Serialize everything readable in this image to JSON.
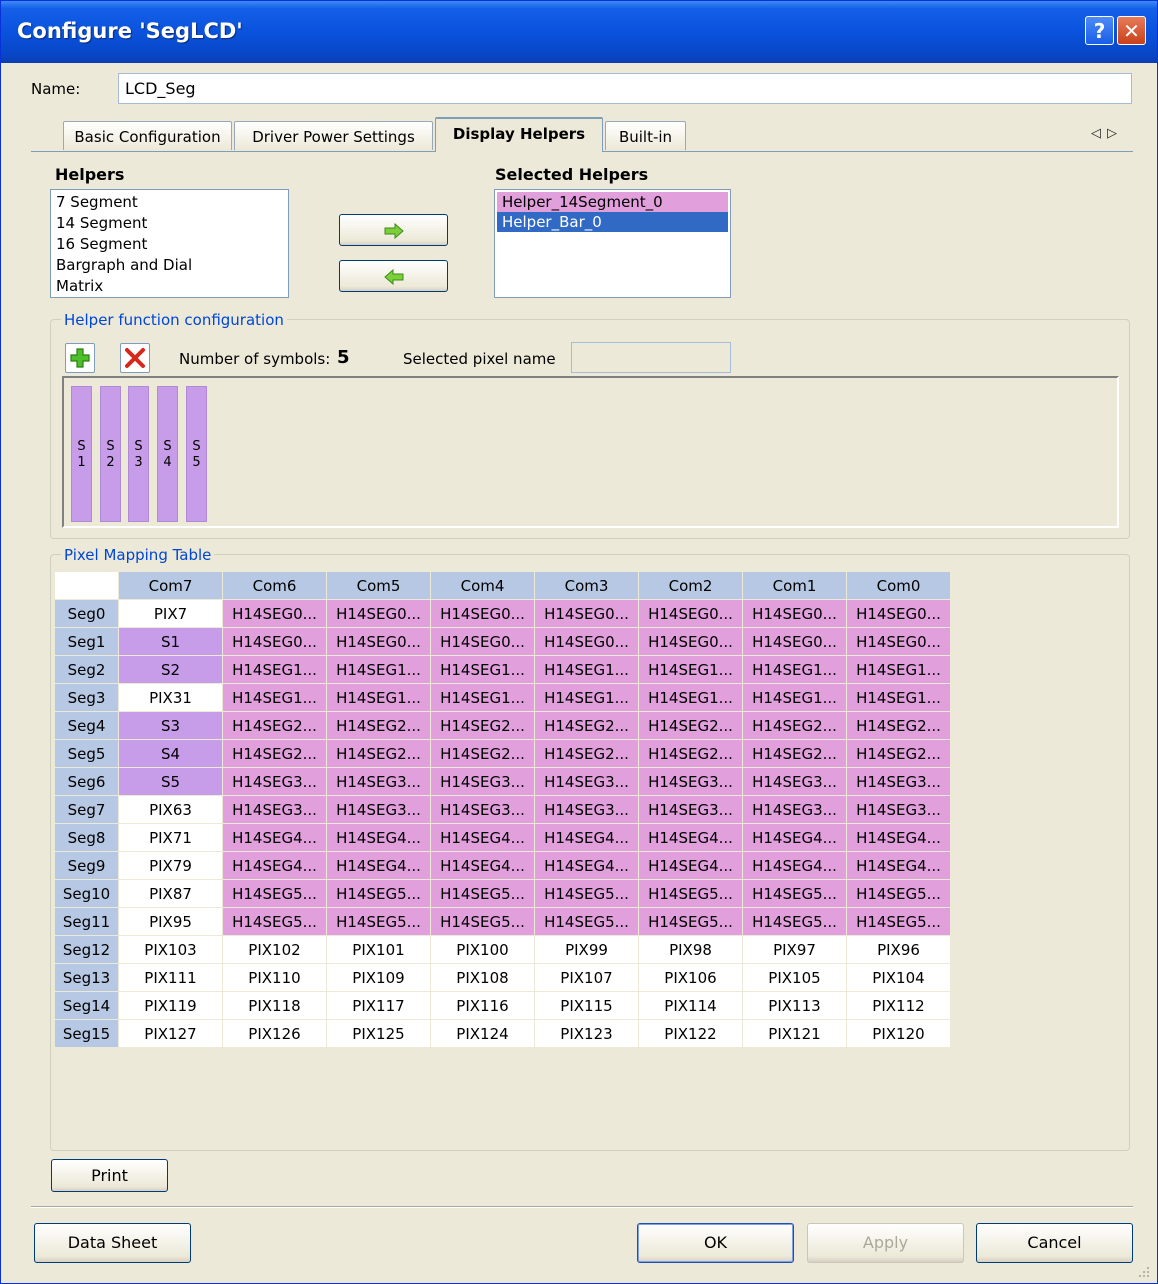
{
  "window": {
    "title": "Configure 'SegLCD'",
    "help_glyph": "?",
    "close_glyph": "✕"
  },
  "name_field": {
    "label": "Name:",
    "value": "LCD_Seg"
  },
  "tabs": [
    {
      "label": "Basic Configuration",
      "active": false
    },
    {
      "label": "Driver Power Settings",
      "active": false
    },
    {
      "label": "Display Helpers",
      "active": true
    },
    {
      "label": "Built-in",
      "active": false
    }
  ],
  "tab_scroll": {
    "left": "◁",
    "right": "▷"
  },
  "helpers": {
    "heading": "Helpers",
    "items": [
      "7 Segment",
      "14 Segment",
      "16 Segment",
      "Bargraph and Dial",
      "Matrix"
    ]
  },
  "selected_helpers": {
    "heading": "Selected Helpers",
    "items": [
      "Helper_14Segment_0",
      "Helper_Bar_0"
    ],
    "item_colors": [
      "#e19fdc",
      "#316ac5"
    ]
  },
  "move_buttons": {
    "add_icon": "arrow-right-icon",
    "remove_icon": "arrow-left-icon"
  },
  "helper_config": {
    "legend": "Helper function configuration",
    "add_icon": "plus-icon",
    "delete_icon": "delete-x-icon",
    "num_symbols_label": "Number of symbols:",
    "num_symbols_value": "5",
    "selected_pixel_label": "Selected pixel name",
    "selected_pixel_value": "",
    "symbols": [
      {
        "l1": "S",
        "l2": "1"
      },
      {
        "l1": "S",
        "l2": "2"
      },
      {
        "l1": "S",
        "l2": "3"
      },
      {
        "l1": "S",
        "l2": "4"
      },
      {
        "l1": "S",
        "l2": "5"
      }
    ]
  },
  "pixel_table": {
    "legend": "Pixel Mapping Table",
    "columns": [
      "Com7",
      "Com6",
      "Com5",
      "Com4",
      "Com3",
      "Com2",
      "Com1",
      "Com0"
    ],
    "colors": {
      "helper_14seg": "#e19fdc",
      "helper_bar": "#c79ce9",
      "header": "#b6c8e3",
      "empty": "#ffffff"
    },
    "rows": [
      {
        "seg": "Seg0",
        "com7": "PIX7",
        "com7_type": "plain",
        "rest": "H14SEG0...",
        "rest_type": "h14"
      },
      {
        "seg": "Seg1",
        "com7": "S1",
        "com7_type": "bar",
        "rest": "H14SEG0...",
        "rest_type": "h14"
      },
      {
        "seg": "Seg2",
        "com7": "S2",
        "com7_type": "bar",
        "rest": "H14SEG1...",
        "rest_type": "h14"
      },
      {
        "seg": "Seg3",
        "com7": "PIX31",
        "com7_type": "plain",
        "rest": "H14SEG1...",
        "rest_type": "h14"
      },
      {
        "seg": "Seg4",
        "com7": "S3",
        "com7_type": "bar",
        "rest": "H14SEG2...",
        "rest_type": "h14"
      },
      {
        "seg": "Seg5",
        "com7": "S4",
        "com7_type": "bar",
        "rest": "H14SEG2...",
        "rest_type": "h14"
      },
      {
        "seg": "Seg6",
        "com7": "S5",
        "com7_type": "bar",
        "rest": "H14SEG3...",
        "rest_type": "h14"
      },
      {
        "seg": "Seg7",
        "com7": "PIX63",
        "com7_type": "plain",
        "rest": "H14SEG3...",
        "rest_type": "h14"
      },
      {
        "seg": "Seg8",
        "com7": "PIX71",
        "com7_type": "plain",
        "rest": "H14SEG4...",
        "rest_type": "h14"
      },
      {
        "seg": "Seg9",
        "com7": "PIX79",
        "com7_type": "plain",
        "rest": "H14SEG4...",
        "rest_type": "h14"
      },
      {
        "seg": "Seg10",
        "com7": "PIX87",
        "com7_type": "plain",
        "rest": "H14SEG5...",
        "rest_type": "h14"
      },
      {
        "seg": "Seg11",
        "com7": "PIX95",
        "com7_type": "plain",
        "rest": "H14SEG5...",
        "rest_type": "h14"
      },
      {
        "seg": "Seg12",
        "cells": [
          "PIX103",
          "PIX102",
          "PIX101",
          "PIX100",
          "PIX99",
          "PIX98",
          "PIX97",
          "PIX96"
        ]
      },
      {
        "seg": "Seg13",
        "cells": [
          "PIX111",
          "PIX110",
          "PIX109",
          "PIX108",
          "PIX107",
          "PIX106",
          "PIX105",
          "PIX104"
        ]
      },
      {
        "seg": "Seg14",
        "cells": [
          "PIX119",
          "PIX118",
          "PIX117",
          "PIX116",
          "PIX115",
          "PIX114",
          "PIX113",
          "PIX112"
        ]
      },
      {
        "seg": "Seg15",
        "cells": [
          "PIX127",
          "PIX126",
          "PIX125",
          "PIX124",
          "PIX123",
          "PIX122",
          "PIX121",
          "PIX120"
        ]
      }
    ]
  },
  "buttons": {
    "print": "Print",
    "data_sheet": "Data Sheet",
    "ok": "OK",
    "apply": "Apply",
    "cancel": "Cancel"
  }
}
